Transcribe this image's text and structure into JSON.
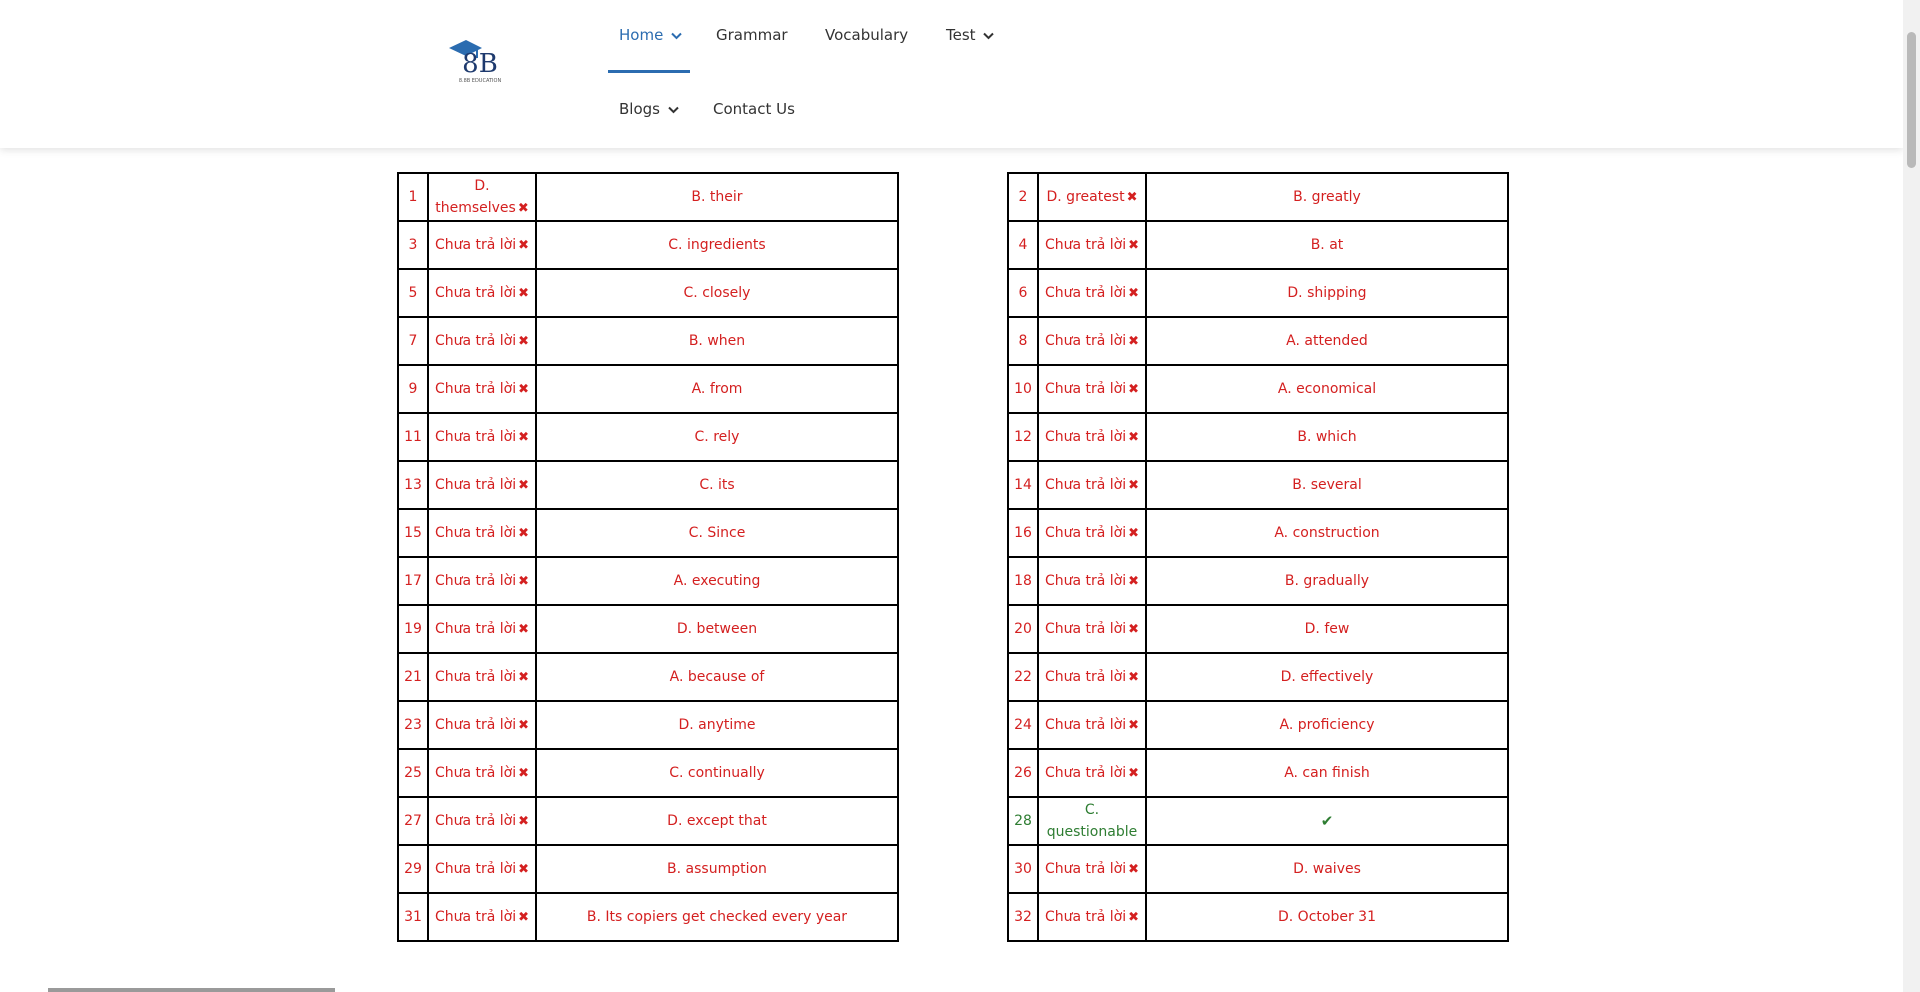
{
  "logo": {
    "text": "8B",
    "tagline": "8.8B EDUCATION"
  },
  "nav": {
    "home": "Home",
    "grammar": "Grammar",
    "vocabulary": "Vocabulary",
    "test": "Test",
    "blogs": "Blogs",
    "contact": "Contact Us"
  },
  "colors": {
    "accent": "#2b6cb0",
    "wrong": "#d42020",
    "right": "#2e7d32"
  },
  "icons": {
    "wrong": "cross-icon",
    "right": "check-icon"
  },
  "marks": {
    "wrong": "✖",
    "right": "✔"
  },
  "left_table": [
    {
      "num": "1",
      "yours": "D. themselves",
      "correct": "B. their",
      "status": "wrong"
    },
    {
      "num": "3",
      "yours": "Chưa trả lời",
      "correct": "C. ingredients",
      "status": "wrong"
    },
    {
      "num": "5",
      "yours": "Chưa trả lời",
      "correct": "C. closely",
      "status": "wrong"
    },
    {
      "num": "7",
      "yours": "Chưa trả lời",
      "correct": "B. when",
      "status": "wrong"
    },
    {
      "num": "9",
      "yours": "Chưa trả lời",
      "correct": "A. from",
      "status": "wrong"
    },
    {
      "num": "11",
      "yours": "Chưa trả lời",
      "correct": "C. rely",
      "status": "wrong"
    },
    {
      "num": "13",
      "yours": "Chưa trả lời",
      "correct": "C. its",
      "status": "wrong"
    },
    {
      "num": "15",
      "yours": "Chưa trả lời",
      "correct": "C. Since",
      "status": "wrong"
    },
    {
      "num": "17",
      "yours": "Chưa trả lời",
      "correct": "A. executing",
      "status": "wrong"
    },
    {
      "num": "19",
      "yours": "Chưa trả lời",
      "correct": "D. between",
      "status": "wrong"
    },
    {
      "num": "21",
      "yours": "Chưa trả lời",
      "correct": "A. because of",
      "status": "wrong"
    },
    {
      "num": "23",
      "yours": "Chưa trả lời",
      "correct": "D. anytime",
      "status": "wrong"
    },
    {
      "num": "25",
      "yours": "Chưa trả lời",
      "correct": "C. continually",
      "status": "wrong"
    },
    {
      "num": "27",
      "yours": "Chưa trả lời",
      "correct": "D. except that",
      "status": "wrong"
    },
    {
      "num": "29",
      "yours": "Chưa trả lời",
      "correct": "B. assumption",
      "status": "wrong"
    },
    {
      "num": "31",
      "yours": "Chưa trả lời",
      "correct": "B. Its copiers get checked every year",
      "status": "wrong"
    }
  ],
  "right_table": [
    {
      "num": "2",
      "yours": "D. greatest",
      "correct": "B. greatly",
      "status": "wrong"
    },
    {
      "num": "4",
      "yours": "Chưa trả lời",
      "correct": "B. at",
      "status": "wrong"
    },
    {
      "num": "6",
      "yours": "Chưa trả lời",
      "correct": "D. shipping",
      "status": "wrong"
    },
    {
      "num": "8",
      "yours": "Chưa trả lời",
      "correct": "A. attended",
      "status": "wrong"
    },
    {
      "num": "10",
      "yours": "Chưa trả lời",
      "correct": "A. economical",
      "status": "wrong"
    },
    {
      "num": "12",
      "yours": "Chưa trả lời",
      "correct": "B. which",
      "status": "wrong"
    },
    {
      "num": "14",
      "yours": "Chưa trả lời",
      "correct": "B. several",
      "status": "wrong"
    },
    {
      "num": "16",
      "yours": "Chưa trả lời",
      "correct": "A. construction",
      "status": "wrong"
    },
    {
      "num": "18",
      "yours": "Chưa trả lời",
      "correct": "B. gradually",
      "status": "wrong"
    },
    {
      "num": "20",
      "yours": "Chưa trả lời",
      "correct": "D. few",
      "status": "wrong"
    },
    {
      "num": "22",
      "yours": "Chưa trả lời",
      "correct": "D. effectively",
      "status": "wrong"
    },
    {
      "num": "24",
      "yours": "Chưa trả lời",
      "correct": "A. proficiency",
      "status": "wrong"
    },
    {
      "num": "26",
      "yours": "Chưa trả lời",
      "correct": "A. can finish",
      "status": "wrong"
    },
    {
      "num": "28",
      "yours": "C. questionable",
      "correct": "",
      "status": "right"
    },
    {
      "num": "30",
      "yours": "Chưa trả lời",
      "correct": "D. waives",
      "status": "wrong"
    },
    {
      "num": "32",
      "yours": "Chưa trả lời",
      "correct": "D. October 31",
      "status": "wrong"
    }
  ]
}
